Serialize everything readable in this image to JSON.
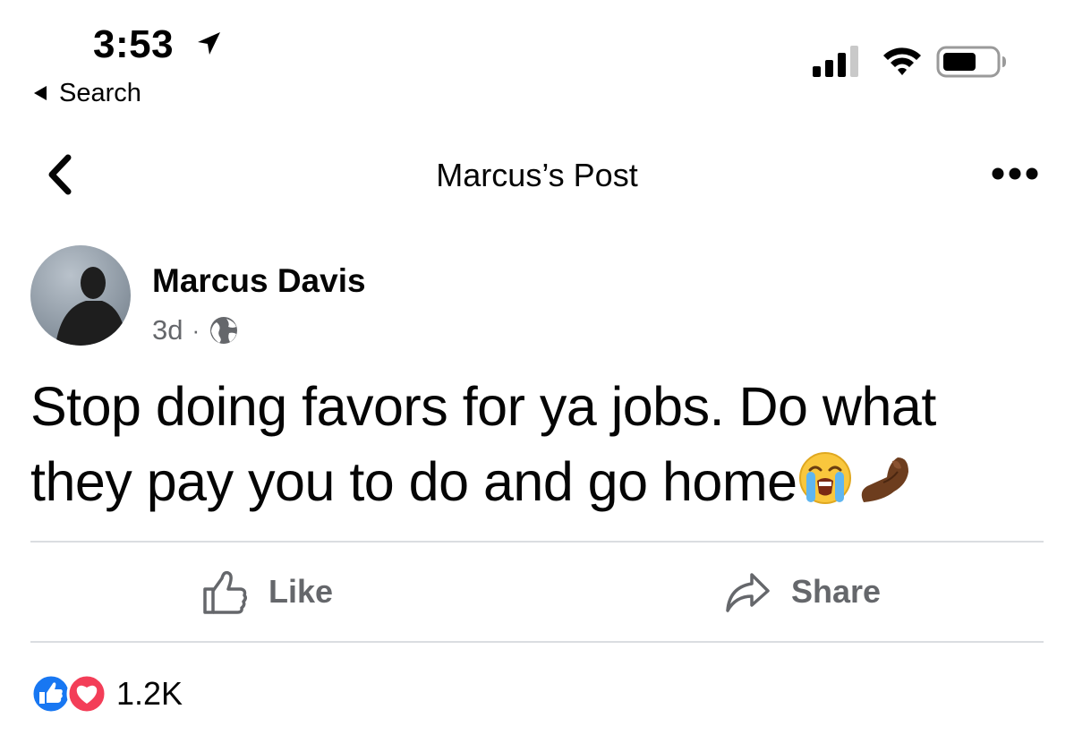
{
  "status_bar": {
    "time": "3:53",
    "back_app_label": "Search"
  },
  "nav": {
    "title": "Marcus’s Post"
  },
  "post": {
    "author": "Marcus Davis",
    "time": "3d",
    "separator": "·",
    "text_line1": "Stop doing favors for ya jobs. Do what",
    "text_line2": "they pay you to do and go home"
  },
  "actions": {
    "like_label": "Like",
    "share_label": "Share"
  },
  "reactions": {
    "count": "1.2K"
  },
  "colors": {
    "like_blue": "#1877f2",
    "love_red": "#f33e58",
    "meta_gray": "#65676b",
    "divider": "#dadde1"
  },
  "icons": [
    "location-arrow-icon",
    "back-caret-icon",
    "signal-icon",
    "wifi-icon",
    "battery-icon",
    "chevron-left-icon",
    "more-icon",
    "globe-icon",
    "thumbs-up-icon",
    "share-arrow-icon",
    "like-reaction-icon",
    "love-reaction-icon",
    "crying-face-emoji",
    "pinched-fingers-emoji"
  ]
}
